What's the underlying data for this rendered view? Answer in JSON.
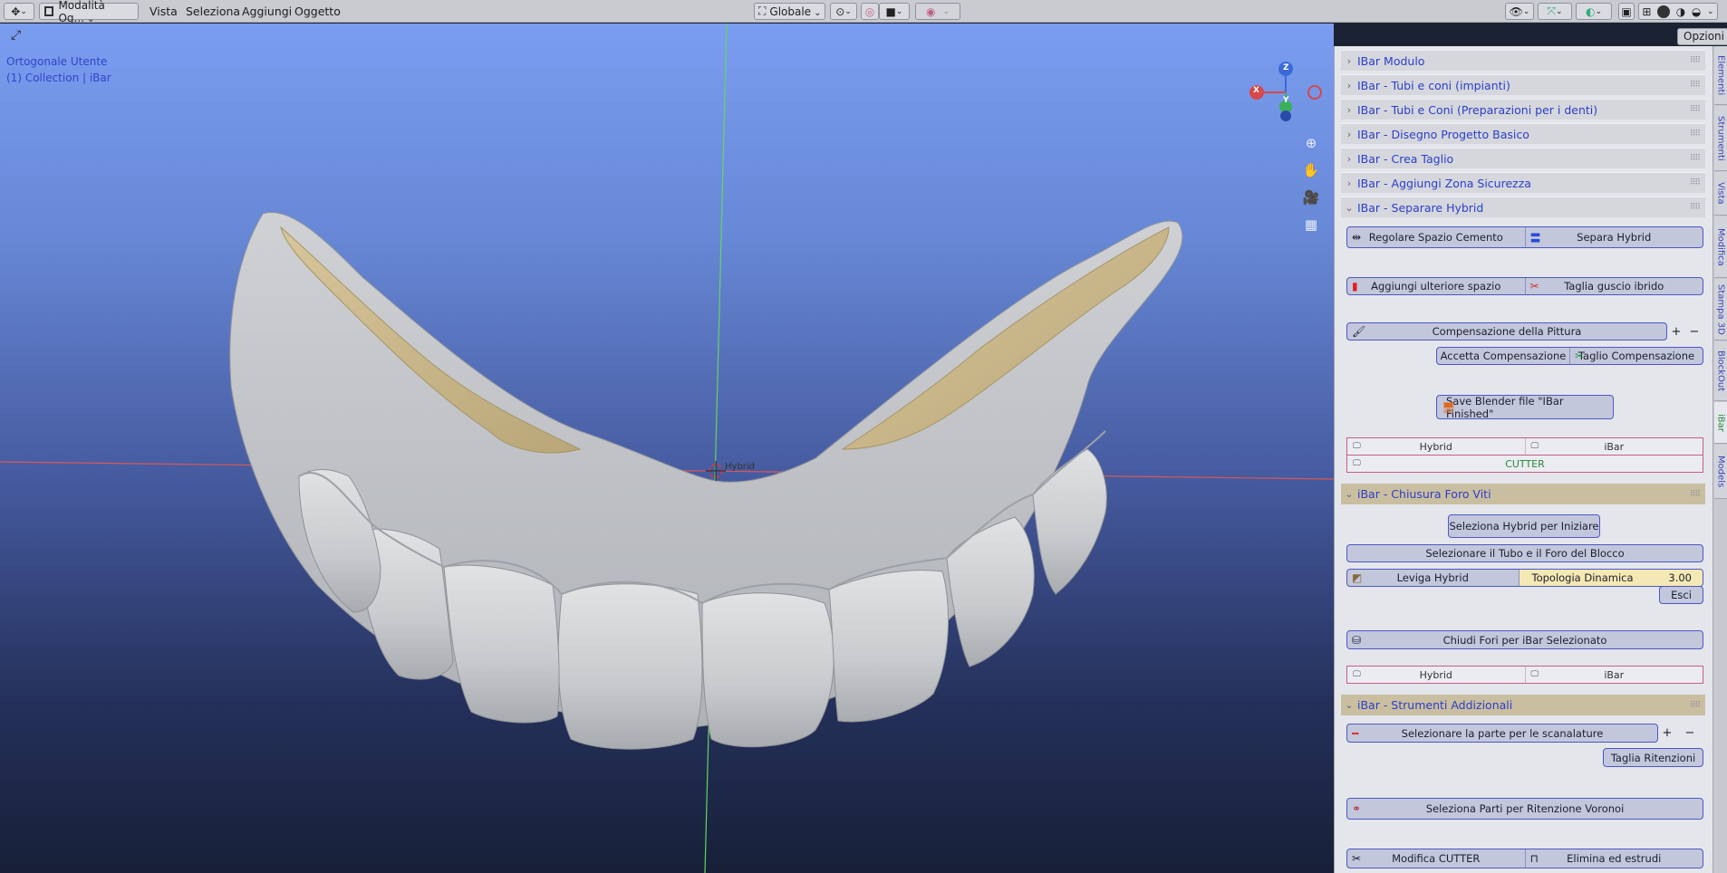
{
  "header": {
    "mode_label": "Modalità Og...",
    "menu": [
      "Vista",
      "Seleziona",
      "Aggiungi",
      "Oggetto"
    ],
    "transform_label": "Globale",
    "options_label": "Opzioni"
  },
  "viewport": {
    "view_name": "Ortogonale Utente",
    "collection": "(1) Collection | iBar",
    "object_label": "Hybrid",
    "gizmo": {
      "x": "X",
      "y": "Y",
      "z": "Z"
    }
  },
  "side_tabs": [
    "Elementi",
    "Strumenti",
    "Vista",
    "Modifica",
    "Stampa 3D",
    "BlockOut",
    "iBar",
    "Models"
  ],
  "panels": [
    {
      "title": "IBar Modulo"
    },
    {
      "title": "IBar - Tubi e coni (impianti)"
    },
    {
      "title": "IBar - Tubi e Coni (Preparazioni per i denti)"
    },
    {
      "title": "IBar - Disegno Progetto Basico"
    },
    {
      "title": "IBar - Crea Taglio"
    },
    {
      "title": "IBar - Aggiungi Zona Sicurezza"
    },
    {
      "title": "IBar - Separare Hybrid"
    },
    {
      "title": "iBar - Chiusura Foro  Viti"
    },
    {
      "title": "iBar - Strumenti Addizionali"
    }
  ],
  "separare": {
    "regolare": "Regolare Spazio Cemento",
    "separa": "Separa Hybrid",
    "aggiungi": "Aggiungi ulteriore spazio",
    "taglia_guscio": "Taglia guscio ibrido",
    "compensazione": "Compensazione della Pittura",
    "accetta": "Accetta Compensazione",
    "taglio_comp": "Taglio Compensazione",
    "save": "Save Blender file \"IBar Finished\"",
    "toggle_hybrid": "Hybrid",
    "toggle_ibar": "iBar",
    "cutter": "CUTTER"
  },
  "chiusura": {
    "seleziona_hybrid": "Seleziona Hybrid per Iniziare",
    "seleziona_tubo": "Selezionare il Tubo e il Foro del Blocco",
    "leviga": "Leviga Hybrid",
    "topologia": "Topologia Dinamica",
    "topologia_value": "3.00",
    "esci": "Esci",
    "chiudi": "Chiudi Fori per iBar Selezionato",
    "toggle_hybrid": "Hybrid",
    "toggle_ibar": "iBar"
  },
  "strumenti": {
    "scanalature": "Selezionare la parte per le scanalature",
    "taglia_ritenzioni": "Taglia Ritenzioni",
    "voronoi": "Seleziona Parti per Ritenzione Voronoi",
    "modifica_cutter": "Modifica CUTTER",
    "elimina": "Elimina ed estrudi"
  },
  "colors": {
    "accent": "#2c3ec8",
    "panel_open": "#c9bea0",
    "button": "#c3c7dc",
    "toggle_border": "#c65f86",
    "cutter": "#2a8a3a"
  },
  "icons": [
    "transform-icon",
    "object-mode-icon",
    "snap-icon",
    "proportional-icon",
    "visibility-icon",
    "gizmo-icon",
    "overlay-icon",
    "xray-icon",
    "shading-icon",
    "zoom-icon",
    "pan-icon",
    "camera-icon",
    "grid-icon"
  ]
}
